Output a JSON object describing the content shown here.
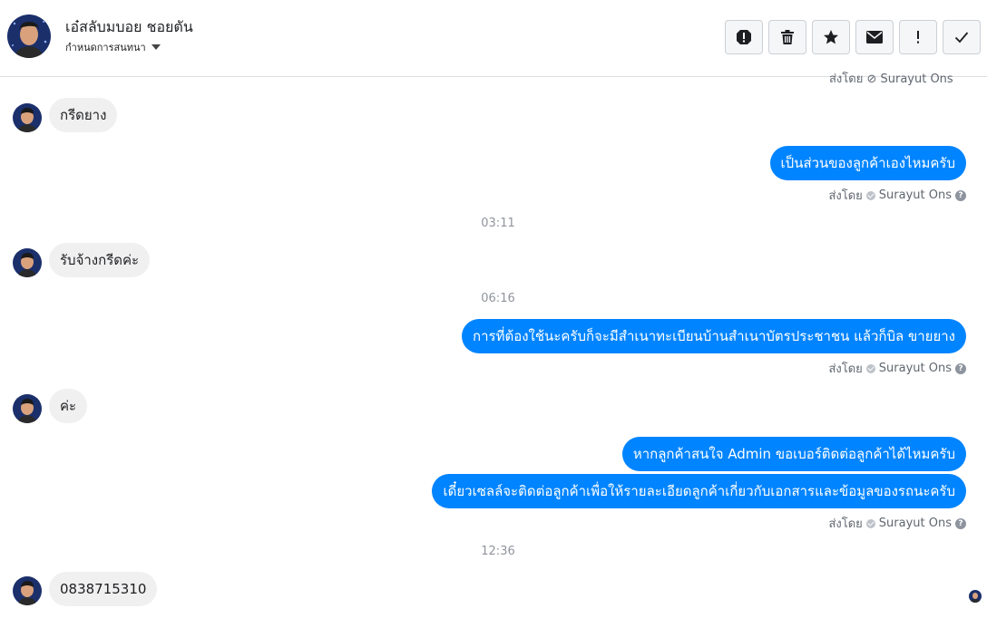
{
  "header": {
    "name": "เอ๋สลับมบอย ชอยตัน",
    "subtitle": "กำหนดการสนทนา",
    "actions": [
      "report-icon",
      "trash-icon",
      "star-icon",
      "mail-icon",
      "exclamation-icon",
      "check-icon"
    ]
  },
  "thread": {
    "clipped_sentby": "ส่งโดย ⊘ Surayut Ons",
    "messages": [
      {
        "dir": "in",
        "text": "กรีดยาง"
      },
      {
        "dir": "out",
        "text": "เป็นส่วนของลูกค้าเองไหมครับ"
      },
      {
        "sentby_label": "ส่งโดย",
        "sentby_name": "Surayut Ons"
      },
      {
        "time": "03:11"
      },
      {
        "dir": "in",
        "text": "รับจ้างกรีดค่ะ"
      },
      {
        "time": "06:16"
      },
      {
        "dir": "out",
        "text": "การที่ต้องใช้นะครับก็จะมีสำเนาทะเบียนบ้านสำเนาบัตรประชาชน แล้วก็บิล ขายยาง"
      },
      {
        "sentby_label": "ส่งโดย",
        "sentby_name": "Surayut Ons"
      },
      {
        "dir": "in",
        "text": "ค่ะ"
      },
      {
        "dir": "out",
        "text": "หากลูกค้าสนใจ Admin ขอเบอร์ติดต่อลูกค้าได้ไหมครับ"
      },
      {
        "dir": "out",
        "text": "เดี๋ยวเซลล์จะติดต่อลูกค้าเพื่อให้รายละเอียดลูกค้าเกี่ยวกับเอกสารและข้อมูลของรถนะครับ"
      },
      {
        "sentby_label": "ส่งโดย",
        "sentby_name": "Surayut Ons"
      },
      {
        "time": "12:36"
      },
      {
        "dir": "in",
        "text": "0838715310"
      }
    ]
  },
  "colors": {
    "outgoing": "#0084ff",
    "incoming": "#f1f0f0",
    "meta": "#606770"
  }
}
